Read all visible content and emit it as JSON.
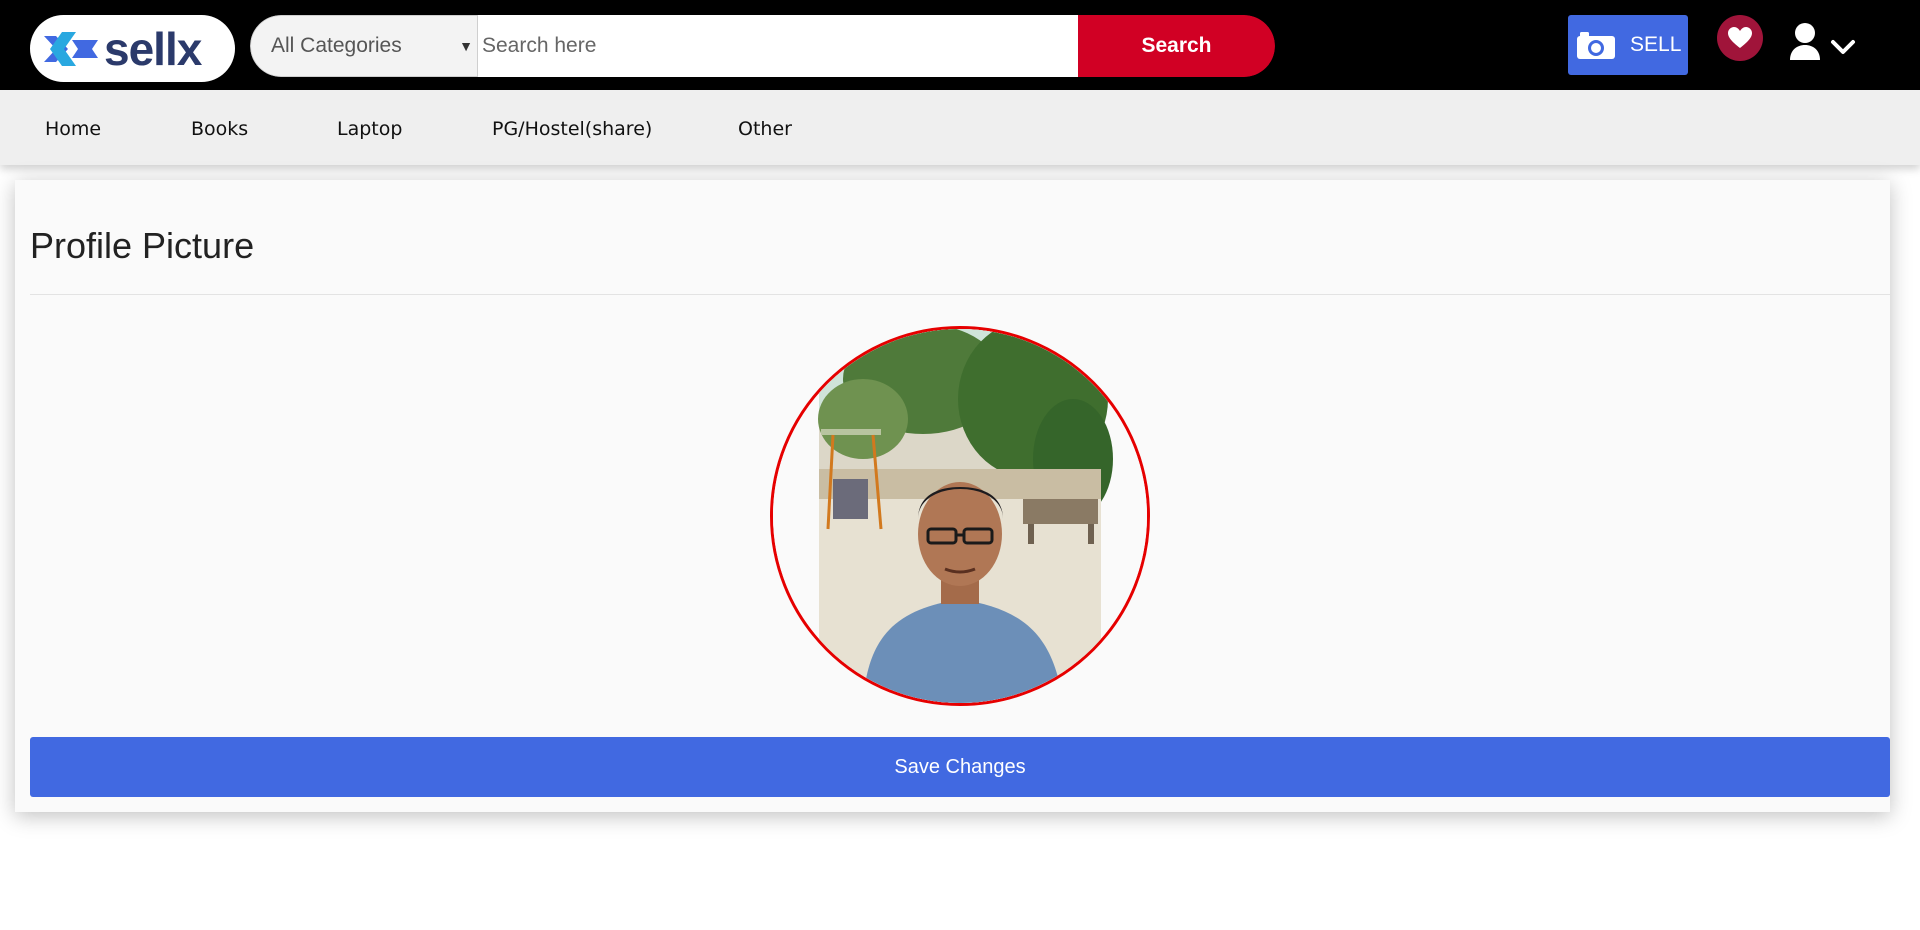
{
  "header": {
    "logo_text": "sellx",
    "category_selected": "All Categories",
    "search_placeholder": "Search here",
    "search_label": "Search",
    "sell_label": "SELL"
  },
  "nav": {
    "items": [
      {
        "label": "Home"
      },
      {
        "label": "Books"
      },
      {
        "label": "Laptop"
      },
      {
        "label": "PG/Hostel(share)"
      },
      {
        "label": "Other"
      }
    ]
  },
  "profile": {
    "title": "Profile Picture",
    "save_label": "Save Changes"
  },
  "colors": {
    "topbar": "#000000",
    "search_button": "#d10024",
    "primary": "#4169e1",
    "favorite": "#a0143a",
    "avatar_border": "#e60000"
  },
  "icons": [
    "sellx-logo-icon",
    "camera-icon",
    "heart-icon",
    "user-icon",
    "chevron-down-icon",
    "select-caret-icon"
  ]
}
